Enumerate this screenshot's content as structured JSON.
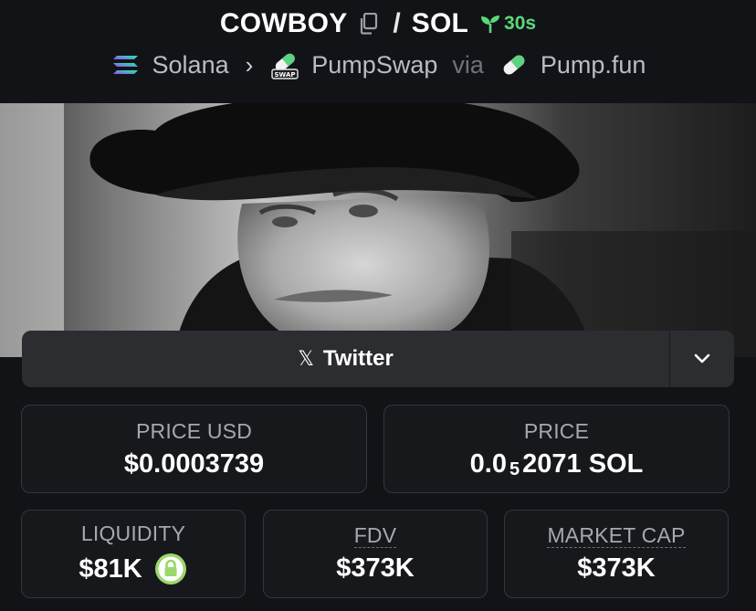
{
  "pair": {
    "base": "COWBOY",
    "separator": "/",
    "quote": "SOL",
    "age": "30s"
  },
  "route": {
    "chain": "Solana",
    "dex": "PumpSwap",
    "via_label": "via",
    "launchpad": "Pump.fun"
  },
  "social": {
    "label": "Twitter",
    "x_glyph": "𝕏"
  },
  "stats": {
    "price_usd": {
      "label": "PRICE USD",
      "value": "$0.0003739"
    },
    "price": {
      "label": "PRICE",
      "prefix": "0.0",
      "zeros": "5",
      "suffix": "2071 SOL"
    },
    "liquidity": {
      "label": "LIQUIDITY",
      "value": "$81K"
    },
    "fdv": {
      "label": "FDV",
      "value": "$373K"
    },
    "market_cap": {
      "label": "MARKET CAP",
      "value": "$373K"
    }
  },
  "colors": {
    "background": "#121317",
    "card_border": "#34363c",
    "age_green": "#59d97a",
    "lock_green": "#9ad86a"
  },
  "icons": [
    "copy-icon",
    "seedling-icon",
    "solana-logo",
    "chevron-right-icon",
    "pumpswap-logo",
    "pill-icon",
    "x-icon",
    "chevron-down-icon",
    "lock-icon"
  ]
}
